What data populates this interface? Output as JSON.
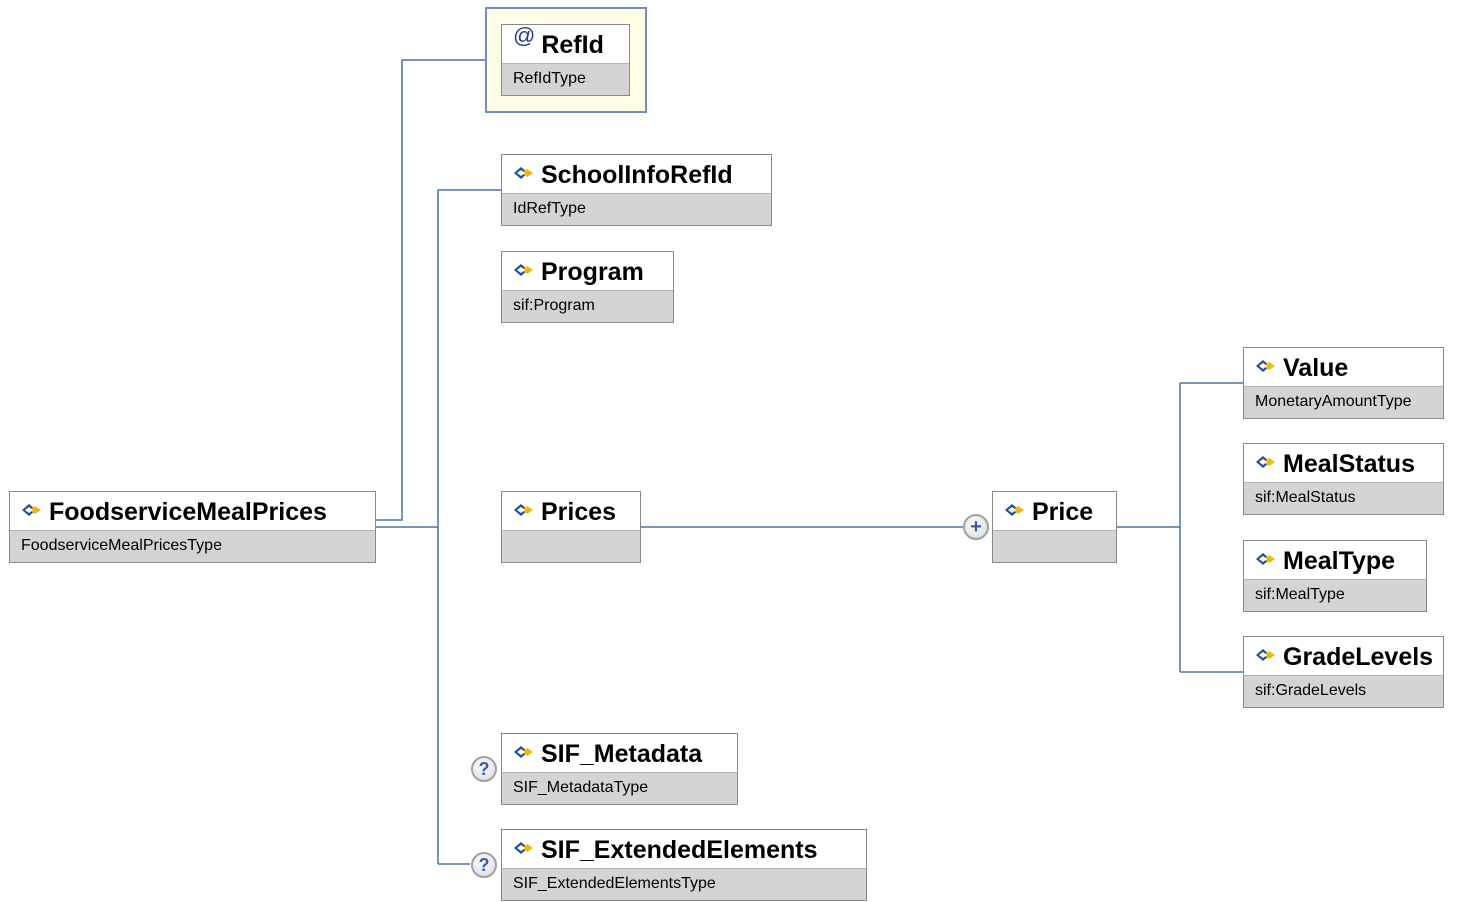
{
  "diagram": {
    "root": {
      "name": "FoodserviceMealPrices",
      "type": "FoodserviceMealPricesType"
    },
    "children": [
      {
        "name": "RefId",
        "type": "RefIdType",
        "kind": "attribute"
      },
      {
        "name": "SchoolInfoRefId",
        "type": "IdRefType"
      },
      {
        "name": "Program",
        "type": "sif:Program"
      },
      {
        "name": "Prices",
        "type": ""
      },
      {
        "name": "SIF_Metadata",
        "type": "SIF_MetadataType",
        "optional": true
      },
      {
        "name": "SIF_ExtendedElements",
        "type": "SIF_ExtendedElementsType",
        "optional": true
      }
    ],
    "price": {
      "name": "Price",
      "type": ""
    },
    "price_children": [
      {
        "name": "Value",
        "type": "MonetaryAmountType"
      },
      {
        "name": "MealStatus",
        "type": "sif:MealStatus"
      },
      {
        "name": "MealType",
        "type": "sif:MealType"
      },
      {
        "name": "GradeLevels",
        "type": "sif:GradeLevels"
      }
    ],
    "symbols": {
      "attribute": "@",
      "optional": "?",
      "expand": "+"
    }
  },
  "colors": {
    "connector": "#4a72a8",
    "type_band": "#d4d4d4",
    "attribute_frame": "#6e8fbf",
    "attribute_fill": "#fffde6",
    "element_icon_blue": "#1a4fa0",
    "element_icon_yellow": "#f2b705"
  }
}
